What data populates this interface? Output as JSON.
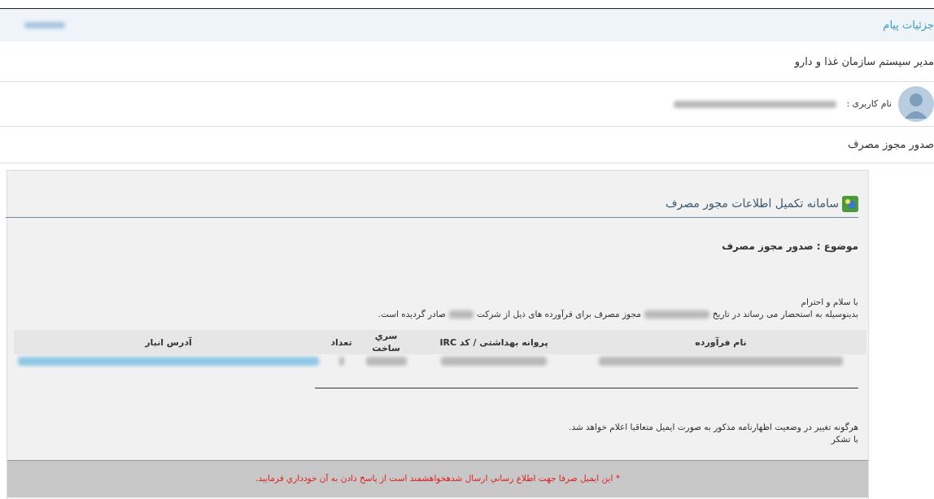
{
  "header": {
    "title": "جزئیات پیام"
  },
  "sender": {
    "name": "مدیر سیستم سازمان غذا و دارو",
    "username_label": "نام کاربری :"
  },
  "subject": "صدور مجوز مصرف",
  "email": {
    "system_title": "سامانه تکمیل اطلاعات مجور مصرف",
    "subject_line": "موضوع : صدور مجوز مصرف",
    "greeting": "با سلام و احترام",
    "body_segments": [
      "بدینوسیله به استحضار می رساند در تاریخ",
      "مجوز مصرف برای فرآورده های ذیل از شرکت",
      "صادر گردیده است."
    ],
    "table": {
      "columns": [
        "نام فرآورده",
        "پروانه بهداشتی / کد IRC",
        "سري ساخت",
        "تعداد",
        "آدرس انبار"
      ]
    },
    "closing": [
      "هرگونه تغییر در وضعیت اظهارنامه مذکور به صورت ایمیل متعاقبا اعلام خواهد شد.",
      "با تشکر"
    ],
    "footer_note": "* اين ايميل صرفا جهت اطلاع رساني ارسال شدهخواهشمند است از پاسخ دادن به آن خودداري فرماييد."
  }
}
